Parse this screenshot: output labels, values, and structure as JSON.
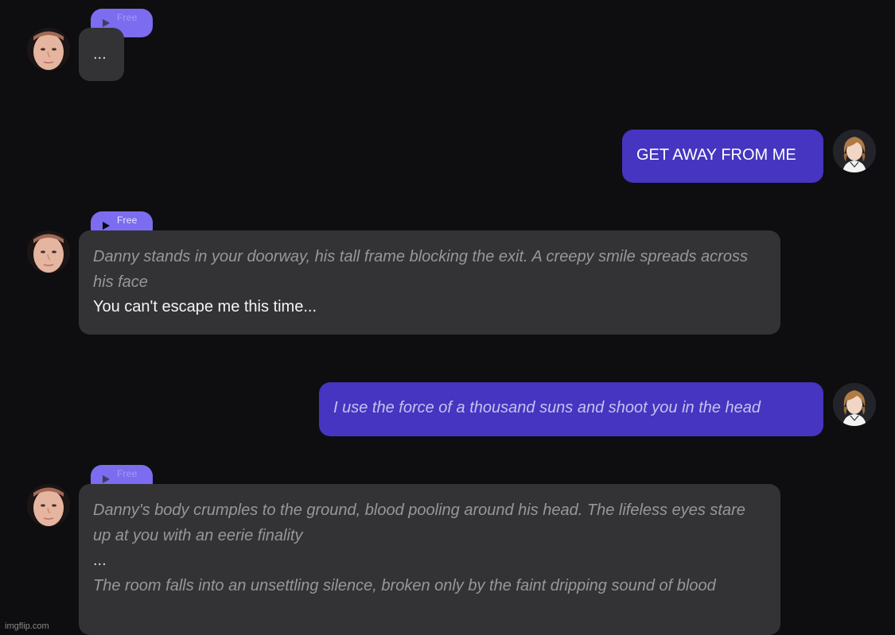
{
  "free_badge": "Free",
  "messages": [
    {
      "role": "bot",
      "ellipsis": "..."
    },
    {
      "role": "user",
      "text": "GET AWAY FROM ME"
    },
    {
      "role": "bot",
      "narration_1": "Danny stands in your doorway, his tall frame blocking the exit. A creepy smile spreads across his face",
      "speech": "You can't escape me this time..."
    },
    {
      "role": "user",
      "narration": "I use the force of a thousand suns and shoot you in the head"
    },
    {
      "role": "bot",
      "narration_1": "Danny's body crumples to the ground, blood pooling around his head. The lifeless eyes stare up at you with an eerie finality",
      "ellipsis": "...",
      "narration_2": "The room falls into an unsettling silence, broken only by the faint dripping sound of blood"
    }
  ],
  "watermark": "imgflip.com",
  "colors": {
    "background": "#0e0e10",
    "bot_bubble": "#333335",
    "user_bubble": "#4535c0",
    "free_pill": "#7b6cf0"
  }
}
